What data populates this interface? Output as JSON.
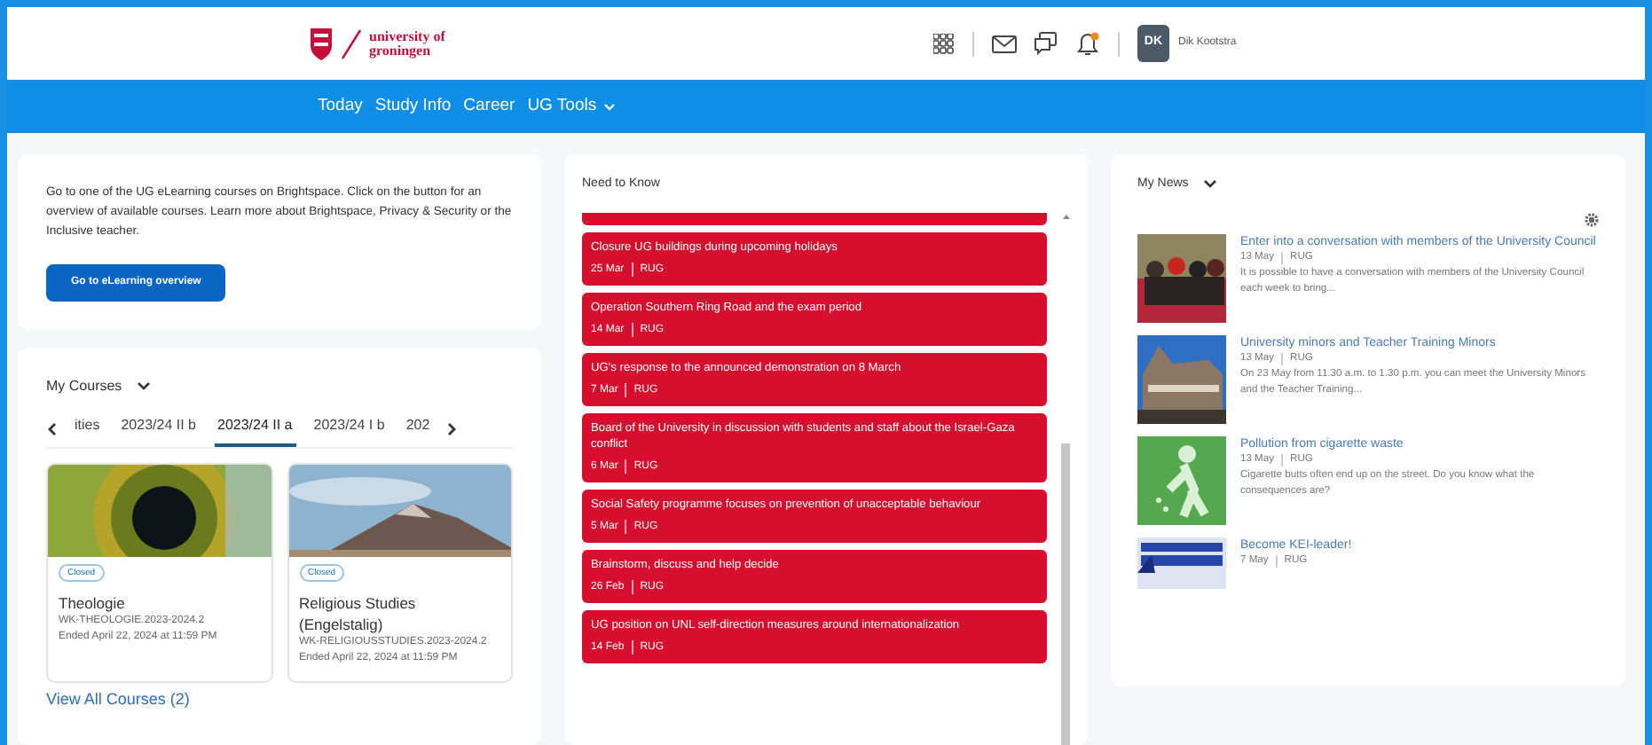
{
  "header": {
    "logo_lines": [
      "university of",
      "groningen"
    ],
    "user": {
      "initials": "DK",
      "name": "Dik Kootstra"
    },
    "notification_dot": true
  },
  "nav": [
    {
      "label": "Today",
      "has_menu": false
    },
    {
      "label": "Study Info",
      "has_menu": false
    },
    {
      "label": "Career",
      "has_menu": false
    },
    {
      "label": "UG Tools",
      "has_menu": true
    }
  ],
  "intro": {
    "text": "Go to one of the UG eLearning courses on Brightspace. Click on the button for an overview of available courses. Learn more about Brightspace, Privacy & Security or the Inclusive teacher.",
    "button": "Go to eLearning overview"
  },
  "my_courses": {
    "title": "My Courses",
    "tabs": [
      {
        "label": "ities",
        "selected": false
      },
      {
        "label": "2023/24 II b",
        "selected": false
      },
      {
        "label": "2023/24 II a",
        "selected": true
      },
      {
        "label": "2023/24 I b",
        "selected": false
      },
      {
        "label": "202",
        "selected": false
      }
    ],
    "courses": [
      {
        "badge": "Closed",
        "title": "Theologie",
        "code": "WK-THEOLOGIE.2023-2024.2",
        "ended": "Ended April 22, 2024 at 11:59 PM"
      },
      {
        "badge": "Closed",
        "title": "Religious Studies (Engelstalig)",
        "code": "WK-RELIGIOUSSTUDIES.2023-2024.2",
        "ended": "Ended April 22, 2024 at 11:59 PM"
      }
    ],
    "link": "View All Courses (2)"
  },
  "need_to_know": {
    "title": "Need to Know",
    "items": [
      {
        "title": "Closure UG buildings during upcoming holidays",
        "date": "25 Mar",
        "source": "RUG"
      },
      {
        "title": "Operation Southern Ring Road and the exam period",
        "date": "14 Mar",
        "source": "RUG"
      },
      {
        "title": "UG's response to the announced demonstration on 8 March",
        "date": "7 Mar",
        "source": "RUG"
      },
      {
        "title": "Board of the University in discussion with students and staff about the Israel-Gaza conflict",
        "date": "6 Mar",
        "source": "RUG"
      },
      {
        "title": "Social Safety programme focuses on prevention of unacceptable behaviour",
        "date": "5 Mar",
        "source": "RUG"
      },
      {
        "title": "Brainstorm, discuss and help decide",
        "date": "26 Feb",
        "source": "RUG"
      },
      {
        "title": "UG position on UNL self-direction measures around internationalization",
        "date": "14 Feb",
        "source": "RUG"
      }
    ]
  },
  "my_news": {
    "title": "My News",
    "items": [
      {
        "title": "Enter into a conversation with members of the University Council",
        "date": "13 May",
        "source": "RUG",
        "summary": "It is possible to have a conversation with members of the University Council each week to bring..."
      },
      {
        "title": "University minors and Teacher Training Minors",
        "date": "13 May",
        "source": "RUG",
        "summary": "On 23 May from 11.30 a.m. to 1.30 p.m. you can meet the University Minors and the Teacher Training..."
      },
      {
        "title": "Pollution from cigarette waste",
        "date": "13 May",
        "source": "RUG",
        "summary": "Cigarette butts often end up on the street. Do you know what the consequences are?"
      },
      {
        "title": "Become KEI-leader!",
        "date": "7 May",
        "source": "RUG"
      }
    ]
  }
}
